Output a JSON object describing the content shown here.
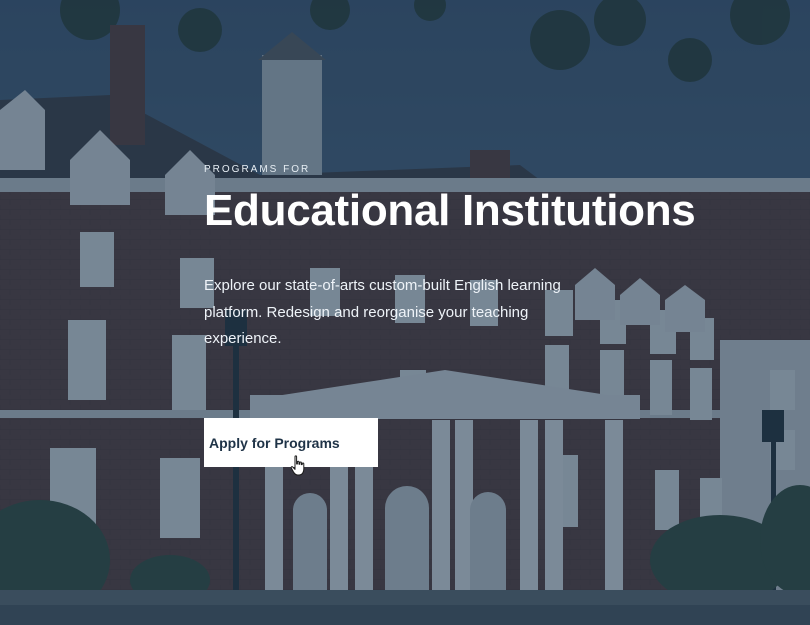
{
  "hero": {
    "eyebrow": "PROGRAMS FOR",
    "title": "Educational Institutions",
    "description": "Explore our state-of-arts custom-built English learning platform. Redesign and reorganise your teaching experience.",
    "cta_label": "Apply for Programs"
  },
  "colors": {
    "overlay": "#1e344e",
    "button_bg": "#ffffff",
    "button_text": "#1f3347",
    "heading": "#ffffff"
  },
  "icons": {
    "cursor": "hand-pointer-icon"
  }
}
